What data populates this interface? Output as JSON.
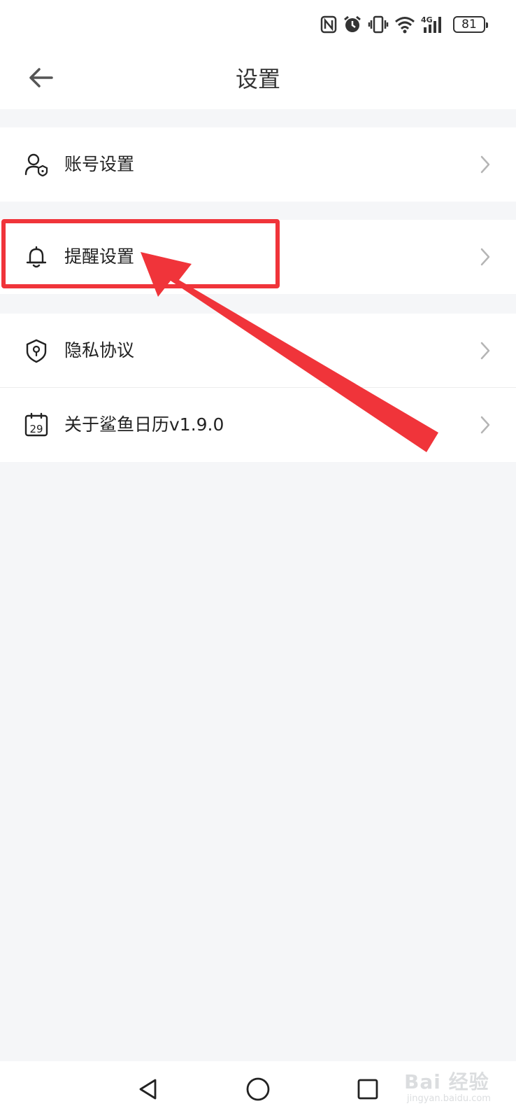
{
  "status_bar": {
    "network_label": "4G",
    "battery_level": "81",
    "icons": [
      "nfc-icon",
      "alarm-icon",
      "vibrate-icon",
      "wifi-icon",
      "signal-icon",
      "battery-icon"
    ]
  },
  "header": {
    "title": "设置",
    "back_icon": "arrow-left-icon"
  },
  "settings": {
    "items": [
      {
        "label": "账号设置",
        "icon": "user-shield-icon"
      },
      {
        "label": "提醒设置",
        "icon": "bell-icon"
      },
      {
        "label": "隐私协议",
        "icon": "privacy-shield-icon"
      },
      {
        "label": "关于鲨鱼日历v1.9.0",
        "icon": "calendar-icon",
        "calendar_day": "29"
      }
    ]
  },
  "annotation": {
    "highlighted_item": "提醒设置",
    "color": "#f0343a"
  },
  "nav_bar": {
    "icons": [
      "back-triangle-icon",
      "home-circle-icon",
      "recents-square-icon"
    ]
  },
  "watermark": {
    "text": "Bai 经验",
    "sub": "jingyan.baidu.com"
  },
  "colors": {
    "background": "#f5f6f8",
    "surface": "#ffffff",
    "text": "#222222",
    "chevron": "#b5b5b5",
    "annotation": "#f0343a"
  }
}
